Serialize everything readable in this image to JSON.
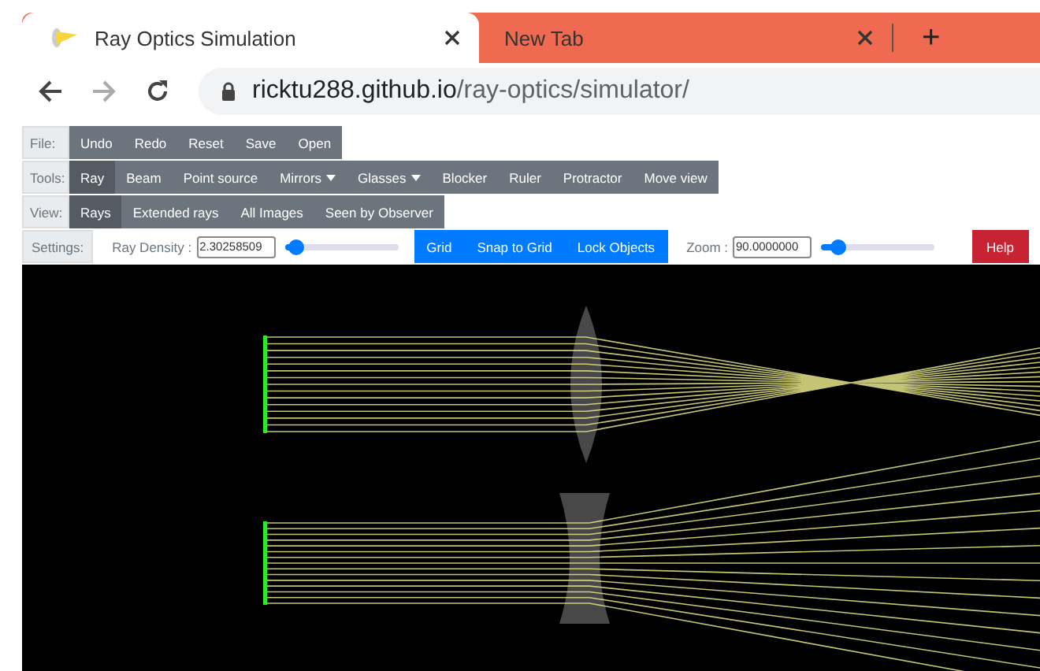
{
  "browser": {
    "tabs": [
      {
        "title": "Ray Optics Simulation",
        "selected": true
      },
      {
        "title": "New Tab",
        "selected": false
      }
    ],
    "new_tab": "+",
    "url_host": "ricktu288.github.io",
    "url_path": "/ray-optics/simulator/"
  },
  "toolbar": {
    "rows": [
      {
        "label": "File:",
        "buttons": [
          {
            "label": "Undo",
            "kind": "plain",
            "selected": false
          },
          {
            "label": "Redo",
            "kind": "plain",
            "selected": false
          },
          {
            "label": "Reset",
            "kind": "plain",
            "selected": false
          },
          {
            "label": "Save",
            "kind": "plain",
            "selected": false
          },
          {
            "label": "Open",
            "kind": "plain",
            "selected": false
          }
        ]
      },
      {
        "label": "Tools:",
        "buttons": [
          {
            "label": "Ray",
            "kind": "plain",
            "selected": true
          },
          {
            "label": "Beam",
            "kind": "plain",
            "selected": false
          },
          {
            "label": "Point source",
            "kind": "plain",
            "selected": false
          },
          {
            "label": "Mirrors",
            "kind": "dropdown",
            "selected": false
          },
          {
            "label": "Glasses",
            "kind": "dropdown",
            "selected": false
          },
          {
            "label": "Blocker",
            "kind": "plain",
            "selected": false
          },
          {
            "label": "Ruler",
            "kind": "plain",
            "selected": false
          },
          {
            "label": "Protractor",
            "kind": "plain",
            "selected": false
          },
          {
            "label": "Move view",
            "kind": "plain",
            "selected": false
          }
        ]
      },
      {
        "label": "View:",
        "buttons": [
          {
            "label": "Rays",
            "kind": "plain",
            "selected": true
          },
          {
            "label": "Extended rays",
            "kind": "plain",
            "selected": false
          },
          {
            "label": "All Images",
            "kind": "plain",
            "selected": false
          },
          {
            "label": "Seen by Observer",
            "kind": "plain",
            "selected": false
          }
        ]
      }
    ],
    "settings": {
      "label": "Settings:",
      "ray_density": {
        "label": "Ray Density :",
        "value": "2.30258509",
        "level": 0.1
      },
      "toggles": [
        "Grid",
        "Snap to Grid",
        "Lock Objects"
      ],
      "zoom": {
        "label": "Zoom :",
        "value": "90.0000000",
        "level": 0.15
      },
      "help": "Help"
    }
  }
}
